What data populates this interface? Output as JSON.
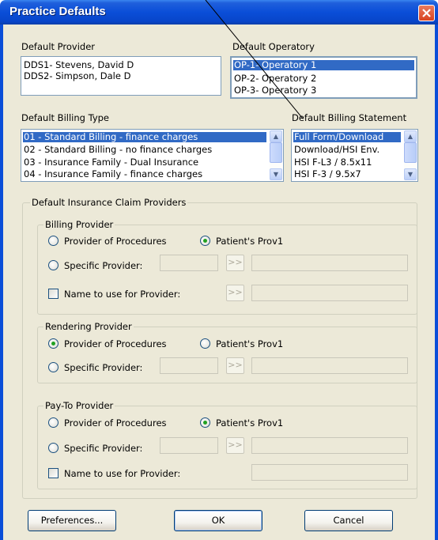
{
  "window": {
    "title": "Practice Defaults",
    "close_glyph": "✕"
  },
  "default_provider": {
    "label": "Default Provider",
    "items": [
      "DDS1- Stevens, David D",
      "DDS2- Simpson, Dale D"
    ]
  },
  "default_operatory": {
    "label": "Default Operatory",
    "items": [
      "OP-1- Operatory 1",
      "OP-2- Operatory 2",
      "OP-3- Operatory 3"
    ],
    "selected_index": 0
  },
  "default_billing_type": {
    "label": "Default Billing Type",
    "items": [
      "01 - Standard Billing - finance charges",
      "02 - Standard Billing - no finance charges",
      "03 - Insurance Family - Dual Insurance",
      "04 - Insurance Family - finance charges"
    ],
    "selected_index": 0
  },
  "default_billing_statement": {
    "label": "Default Billing Statement",
    "items": [
      "Full Form/Download",
      "Download/HSI Env.",
      "HSI F-L3 / 8.5x11",
      "HSI F-3 / 9.5x7"
    ],
    "selected_index": 0
  },
  "scroll": {
    "up_glyph": "▲",
    "down_glyph": "▼"
  },
  "claim_providers": {
    "label": "Default Insurance Claim Providers",
    "billing": {
      "label": "Billing Provider",
      "provider_of_procedures": "Provider of Procedures",
      "patients_prov1": "Patient's Prov1",
      "specific_provider": "Specific Provider:",
      "name_to_use": "Name to use for Provider:",
      "selected": "patients_prov1",
      "name_checked": false
    },
    "rendering": {
      "label": "Rendering Provider",
      "provider_of_procedures": "Provider of Procedures",
      "patients_prov1": "Patient's Prov1",
      "specific_provider": "Specific Provider:",
      "selected": "provider_of_procedures"
    },
    "pay_to": {
      "label": "Pay-To Provider",
      "provider_of_procedures": "Provider of Procedures",
      "patients_prov1": "Patient's Prov1",
      "specific_provider": "Specific Provider:",
      "name_to_use": "Name to use for Provider:",
      "selected": "patients_prov1",
      "name_checked": false
    },
    "browse_glyph": ">>"
  },
  "buttons": {
    "preferences": "Preferences...",
    "ok": "OK",
    "cancel": "Cancel"
  },
  "colors": {
    "title_bar": "#0a4ed8",
    "selection": "#316ac5",
    "dialog_face": "#ece9d8",
    "close_button": "#d9431f"
  }
}
